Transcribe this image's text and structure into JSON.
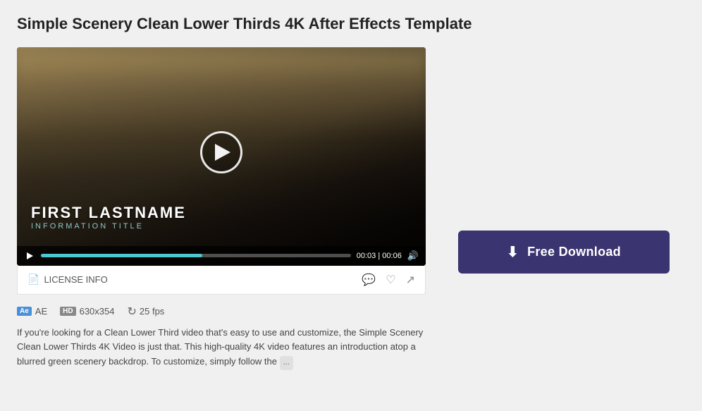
{
  "page": {
    "title": "Simple Scenery Clean Lower Thirds 4K After Effects Template"
  },
  "video": {
    "lower_third_name": "FIRST LASTNAME",
    "lower_third_title": "INFORMATION TITLE",
    "time_current": "00:03",
    "time_total": "00:06",
    "progress_percent": 52
  },
  "footer": {
    "license_info_label": "LICENSE INFO",
    "comment_icon": "💬",
    "like_icon": "♡",
    "share_icon": "↗"
  },
  "meta": {
    "ae_badge": "Ae",
    "ae_label": "AE",
    "hd_badge": "HD",
    "resolution": "630x354",
    "fps_icon": "↻",
    "fps": "25 fps"
  },
  "description": "If you're looking for a Clean Lower Third video that's easy to use and customize, the Simple Scenery Clean Lower Thirds 4K Video is just that. This high-quality 4K video features an introduction atop a blurred green scenery backdrop. To customize, simply follow the",
  "more_label": "...",
  "download": {
    "label": "Free Download",
    "icon": "⬇"
  }
}
